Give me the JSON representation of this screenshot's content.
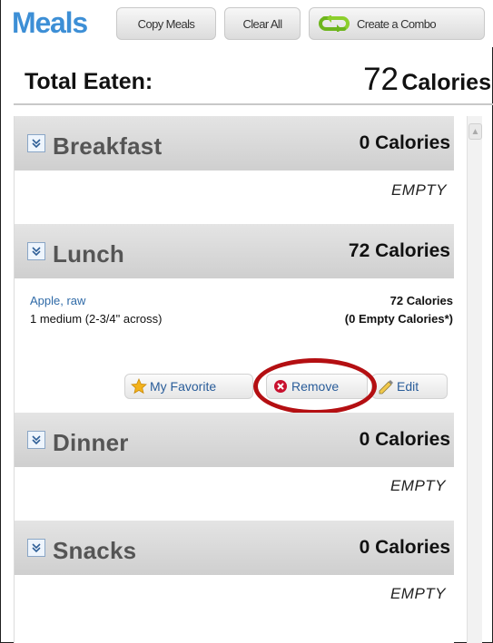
{
  "toolbar": {
    "title": "Meals",
    "copy_label": "Copy Meals",
    "clear_label": "Clear All",
    "combo_label": "Create a Combo"
  },
  "total": {
    "label": "Total Eaten:",
    "value": "72",
    "unit": "Calories"
  },
  "meals": {
    "breakfast": {
      "name": "Breakfast",
      "calories": "0 Calories",
      "empty": "EMPTY"
    },
    "lunch": {
      "name": "Lunch",
      "calories": "72 Calories",
      "food": {
        "name": "Apple, raw",
        "serving": "1 medium (2-3/4\" across)",
        "calories": "72 Calories",
        "empty_calories": "(0 Empty Calories*)"
      },
      "actions": {
        "favorite_label": "My Favorite",
        "remove_label": "Remove",
        "edit_label": "Edit"
      }
    },
    "dinner": {
      "name": "Dinner",
      "calories": "0 Calories",
      "empty": "EMPTY"
    },
    "snacks": {
      "name": "Snacks",
      "calories": "0 Calories",
      "empty": "EMPTY"
    }
  },
  "icons": {
    "toggle": "chevron-down-icon",
    "favorite": "star-icon",
    "remove": "remove-icon",
    "edit": "pencil-icon",
    "combo": "combo-arrows-icon"
  },
  "colors": {
    "accent": "#3d8fd6",
    "link": "#2f6aa7",
    "highlight": "#b40f12",
    "remove": "#c8102e"
  }
}
